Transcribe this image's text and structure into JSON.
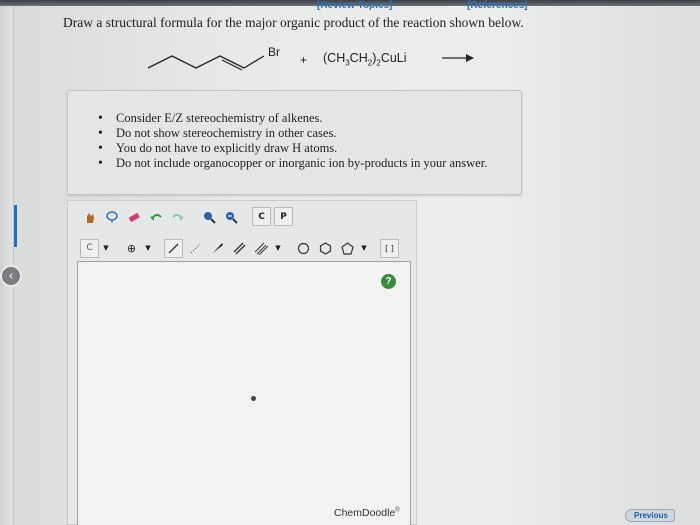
{
  "header": {
    "review_topics": "[Review Topics]",
    "references": "[References]"
  },
  "question": "Draw a structural formula for the major organic product of the reaction shown below.",
  "reaction": {
    "leaving_group": "Br",
    "plus": "+",
    "reagent_prefix": "(CH",
    "reagent_sub1": "3",
    "reagent_mid": "CH",
    "reagent_sub2": "2",
    "reagent_close": ")",
    "reagent_sub3": "2",
    "reagent_suffix": "CuLi"
  },
  "hints": [
    "Consider E/Z stereochemistry of alkenes.",
    "Do not show stereochemistry in other cases.",
    "You do not have to explicitly draw H atoms.",
    "Do not include organocopper or inorganic ion by-products in your answer."
  ],
  "editor": {
    "brand": "ChemDoodle",
    "brand_mark": "®",
    "help_label": "?",
    "toolbar_text": {
      "clear": "C",
      "paste": "P",
      "atom": "C",
      "charge": "⊕",
      "bracket": "[ ]"
    }
  },
  "nav": {
    "previous": "Previous"
  },
  "icons": [
    "back-arrow-icon",
    "hand-icon",
    "lasso-icon",
    "eraser-icon",
    "undo-icon",
    "redo-icon",
    "zoom-in-icon",
    "zoom-out-icon",
    "clean-icon",
    "template-icon",
    "single-bond-icon",
    "wedge-bond-icon",
    "double-bond-icon",
    "triple-bond-icon",
    "ring-icon",
    "help-icon"
  ],
  "colors": {
    "link": "#2f6fb0",
    "help": "#3a8a3c",
    "accent_bar": "#1f6fd0"
  }
}
